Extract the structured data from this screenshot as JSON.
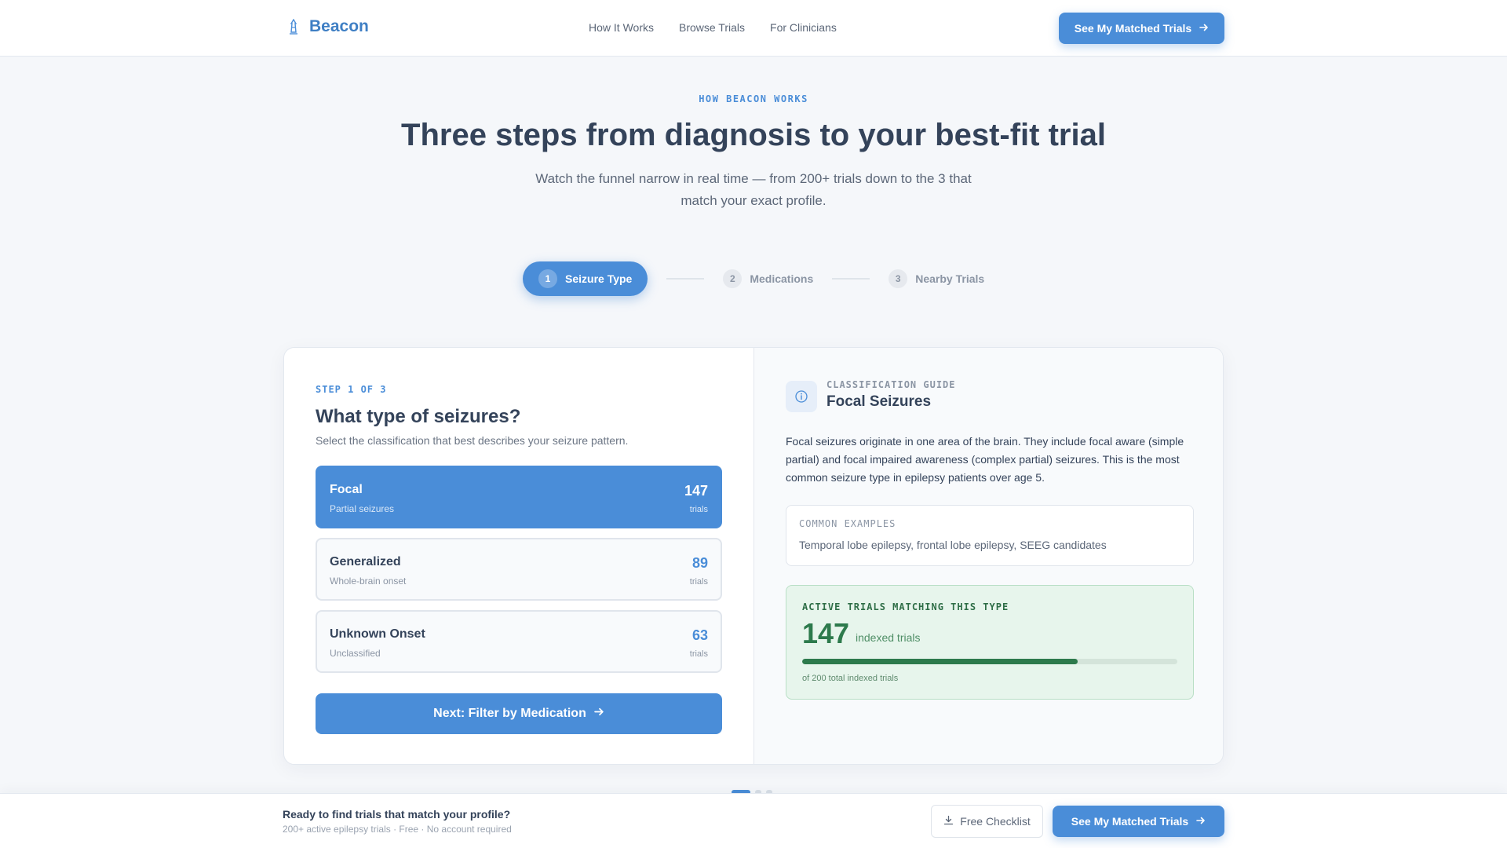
{
  "header": {
    "brand": "Beacon",
    "brand_icon": "beacon-logo-icon",
    "nav": [
      "How It Works",
      "Browse Trials",
      "For Clinicians"
    ],
    "cta_label": "See My Matched Trials"
  },
  "hero": {
    "eyebrow": "HOW BEACON WORKS",
    "title": "Three steps from diagnosis to your best-fit trial",
    "subtitle": "Watch the funnel narrow in real time — from 200+ trials down to the 3 that match your exact profile."
  },
  "stepper": {
    "steps": [
      {
        "num": "1",
        "label": "Seizure Type",
        "active": true
      },
      {
        "num": "2",
        "label": "Medications",
        "active": false
      },
      {
        "num": "3",
        "label": "Nearby Trials",
        "active": false
      }
    ]
  },
  "question": {
    "step_label": "STEP 1 OF 3",
    "title": "What type of seizures?",
    "subtitle": "Select the classification that best describes your seizure pattern.",
    "options": [
      {
        "name": "Focal",
        "desc": "Partial seizures",
        "count": "147",
        "unit": "trials",
        "selected": true
      },
      {
        "name": "Generalized",
        "desc": "Whole-brain onset",
        "count": "89",
        "unit": "trials",
        "selected": false
      },
      {
        "name": "Unknown Onset",
        "desc": "Unclassified",
        "count": "63",
        "unit": "trials",
        "selected": false
      }
    ],
    "next_label": "Next: Filter by Medication"
  },
  "guide": {
    "label": "CLASSIFICATION GUIDE",
    "title": "Focal Seizures",
    "description": "Focal seizures originate in one area of the brain. They include focal aware (simple partial) and focal impaired awareness (complex partial) seizures. This is the most common seizure type in epilepsy patients over age 5.",
    "examples_label": "COMMON EXAMPLES",
    "examples_text": "Temporal lobe epilepsy, frontal lobe epilepsy, SEEG candidates"
  },
  "match": {
    "label": "ACTIVE TRIALS MATCHING THIS TYPE",
    "count": "147",
    "unit": "indexed trials",
    "fraction": 0.735,
    "footnote": "of 200 total indexed trials"
  },
  "pagination": {
    "total": 3,
    "active": 1
  },
  "bottom_bar": {
    "title": "Ready to find trials that match your profile?",
    "subtitle": "200+ active epilepsy trials · Free · No account required",
    "checklist_label": "Free Checklist",
    "cta_label": "See My Matched Trials"
  },
  "colors": {
    "accent": "#4a8dd8",
    "success": "#2d7a4c",
    "text": "#34435a"
  }
}
